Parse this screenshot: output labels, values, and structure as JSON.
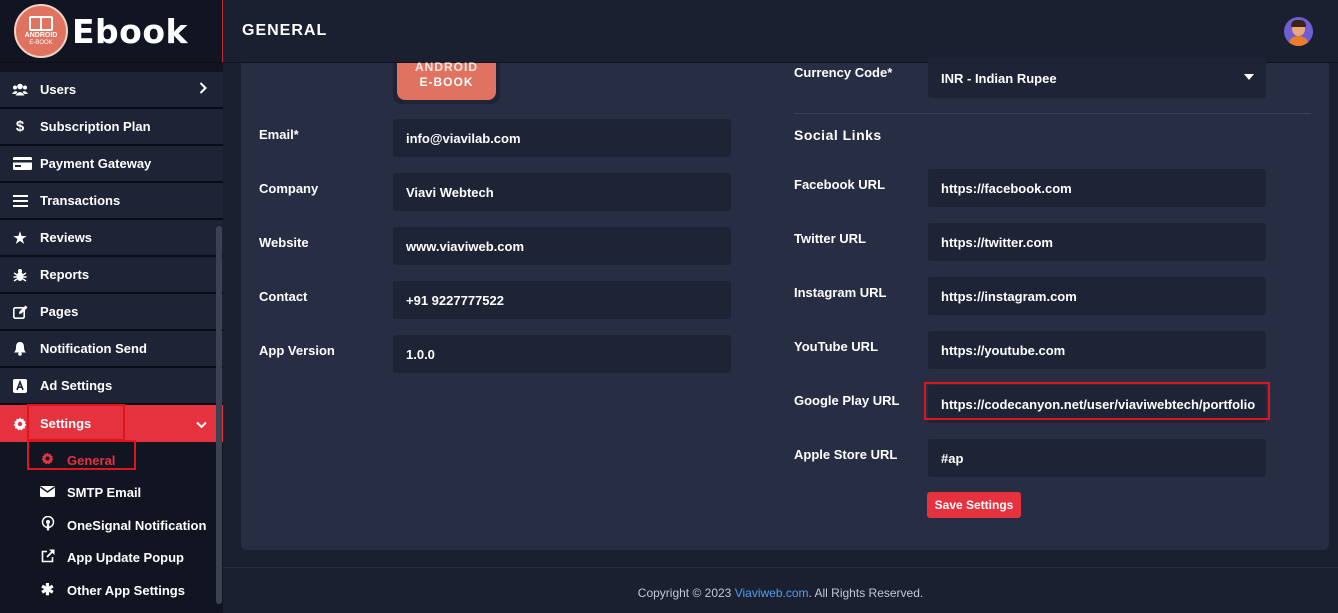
{
  "brand": {
    "logo_line1": "ANDROID",
    "logo_line2": "E-BOOK",
    "name": "Ebook"
  },
  "sidebar": {
    "items": [
      {
        "label": "Users",
        "icon": "users-icon",
        "has_chevron": true
      },
      {
        "label": "Subscription Plan",
        "icon": "dollar-icon"
      },
      {
        "label": "Payment Gateway",
        "icon": "credit-card-icon"
      },
      {
        "label": "Transactions",
        "icon": "list-icon"
      },
      {
        "label": "Reviews",
        "icon": "star-icon"
      },
      {
        "label": "Reports",
        "icon": "bug-icon"
      },
      {
        "label": "Pages",
        "icon": "edit-icon"
      },
      {
        "label": "Notification Send",
        "icon": "bell-icon"
      },
      {
        "label": "Ad Settings",
        "icon": "ad-icon"
      },
      {
        "label": "Settings",
        "icon": "gear-icon",
        "active": true
      }
    ],
    "settings_sub": [
      {
        "label": "General",
        "icon": "gear-icon",
        "current": true
      },
      {
        "label": "SMTP Email",
        "icon": "envelope-icon"
      },
      {
        "label": "OneSignal Notification",
        "icon": "podcast-icon"
      },
      {
        "label": "App Update Popup",
        "icon": "external-link-icon"
      },
      {
        "label": "Other App Settings",
        "icon": "asterisk-icon"
      }
    ]
  },
  "header": {
    "title": "GENERAL"
  },
  "app_logo": {
    "line1": "ANDROID",
    "line2": "E-BOOK"
  },
  "form": {
    "email": {
      "label": "Email*",
      "value": "info@viavilab.com"
    },
    "company": {
      "label": "Company",
      "value": "Viavi Webtech"
    },
    "website": {
      "label": "Website",
      "value": "www.viaviweb.com"
    },
    "contact": {
      "label": "Contact",
      "value": "+91 9227777522"
    },
    "app_version": {
      "label": "App Version",
      "value": "1.0.0"
    },
    "currency": {
      "label": "Currency Code*",
      "value": "INR - Indian Rupee"
    }
  },
  "social": {
    "title": "Social Links",
    "facebook": {
      "label": "Facebook URL",
      "value": "https://facebook.com"
    },
    "twitter": {
      "label": "Twitter URL",
      "value": "https://twitter.com"
    },
    "instagram": {
      "label": "Instagram URL",
      "value": "https://instagram.com"
    },
    "youtube": {
      "label": "YouTube URL",
      "value": "https://youtube.com"
    },
    "google_play": {
      "label": "Google Play URL",
      "value": "https://codecanyon.net/user/viaviwebtech/portfolio"
    },
    "apple_store": {
      "label": "Apple Store URL",
      "value": "#ap"
    }
  },
  "save_label": "Save Settings",
  "footer": {
    "prefix": "Copyright © 2023 ",
    "link": "Viaviweb.com",
    "suffix": ". All Rights Reserved."
  },
  "colors": {
    "accent": "#e6323f",
    "sidebar": "#1e2436",
    "background": "#1b2031",
    "card": "#272d42",
    "field": "#1e2436",
    "link": "#4f9cf2"
  }
}
